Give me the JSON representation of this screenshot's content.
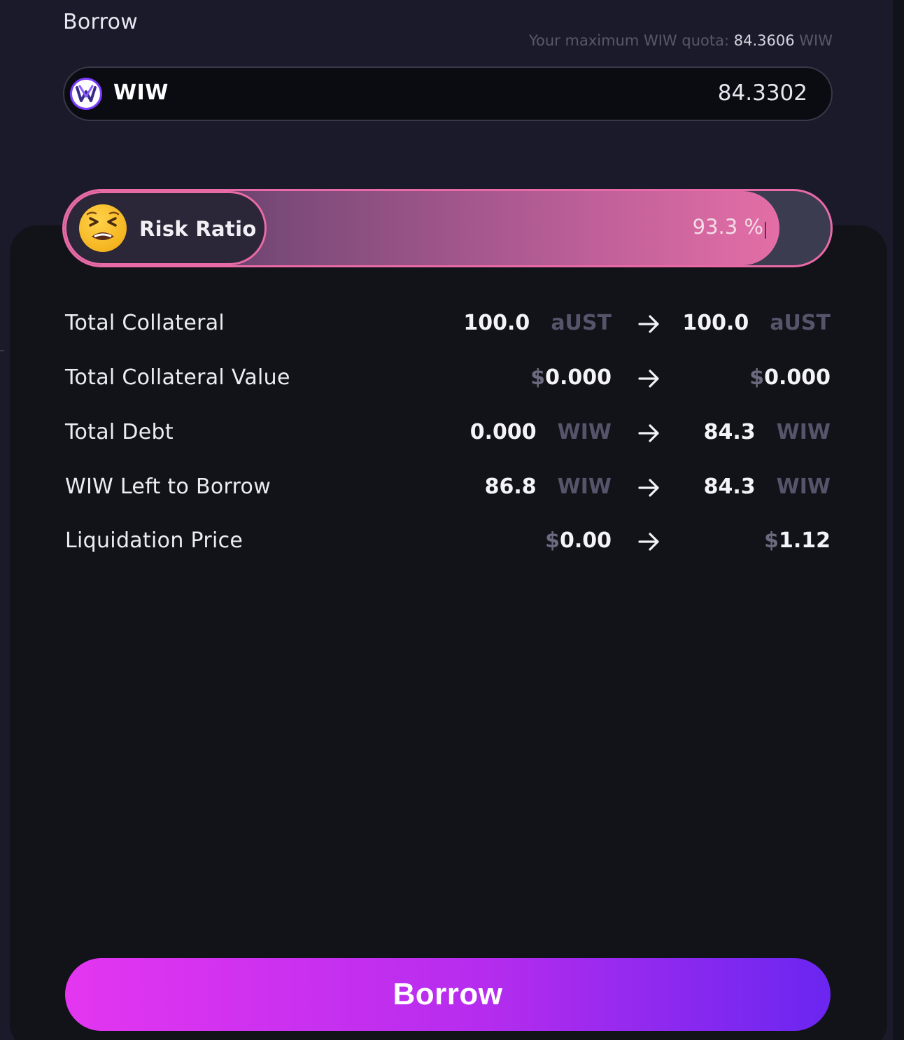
{
  "header": {
    "title": "Borrow",
    "quota_label": "Your maximum WIW quota:",
    "quota_value": "84.3606",
    "quota_unit": "WIW"
  },
  "amount_input": {
    "token_icon": "wiw-token-icon",
    "token": "WIW",
    "value": "84.3302"
  },
  "risk": {
    "emoji_icon": "tired-face-emoji",
    "label": "Risk Ratio",
    "value_text": "93.3 %",
    "level_percent": 93.3,
    "bar_color": "#e86aa6"
  },
  "details": {
    "rows": [
      {
        "label": "Total Collateral",
        "cur_num": "100.0",
        "cur_unit": "aUST",
        "new_num": "100.0",
        "new_unit": "aUST"
      },
      {
        "label": "Total Collateral Value",
        "cur_dollar": "$",
        "cur_num": "0.000",
        "new_dollar": "$",
        "new_num": "0.000"
      },
      {
        "label": "Total Debt",
        "cur_num": "0.000",
        "cur_unit": "WIW",
        "new_num": "84.3",
        "new_unit": "WIW"
      },
      {
        "label": "WIW Left to Borrow",
        "cur_num": "86.8",
        "cur_unit": "WIW",
        "new_num": "84.3",
        "new_unit": "WIW"
      },
      {
        "label": "Liquidation Price",
        "cur_dollar": "$",
        "cur_num": "0.00",
        "new_dollar": "$",
        "new_num": "1.12"
      }
    ],
    "arrow_icon": "arrow-right-icon"
  },
  "action": {
    "button_label": "Borrow",
    "gradient_start": "#e436f0",
    "gradient_end": "#6a26f0"
  }
}
